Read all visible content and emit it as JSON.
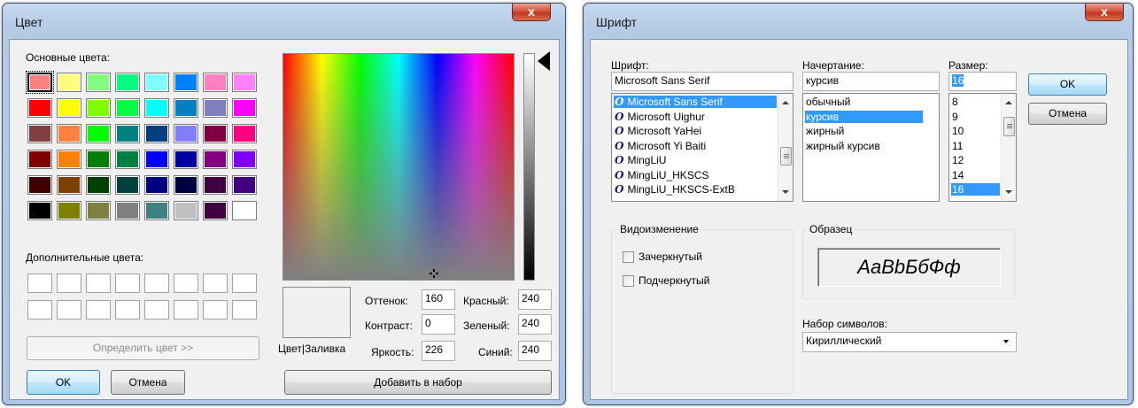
{
  "color_dialog": {
    "title": "Цвет",
    "close_label": "x",
    "basic_colors_label": "Основные цвета:",
    "basic_colors": [
      [
        "#ff8080",
        "#ffff80",
        "#80ff80",
        "#00ff80",
        "#80ffff",
        "#0080ff",
        "#ff80c0",
        "#ff80ff"
      ],
      [
        "#ff0000",
        "#ffff00",
        "#80ff00",
        "#00ff40",
        "#00ffff",
        "#0080c0",
        "#8080c0",
        "#ff00ff"
      ],
      [
        "#804040",
        "#ff8040",
        "#00ff00",
        "#008080",
        "#004080",
        "#8080ff",
        "#800040",
        "#ff0080"
      ],
      [
        "#800000",
        "#ff8000",
        "#008000",
        "#008040",
        "#0000ff",
        "#0000a0",
        "#800080",
        "#8000ff"
      ],
      [
        "#400000",
        "#804000",
        "#004000",
        "#004040",
        "#000080",
        "#000040",
        "#400040",
        "#400080"
      ],
      [
        "#000000",
        "#808000",
        "#808040",
        "#808080",
        "#408080",
        "#c0c0c0",
        "#400040",
        "#ffffff"
      ]
    ],
    "custom_colors_label": "Дополнительные цвета:",
    "define_button": "Определить цвет >>",
    "ok_button": "OK",
    "cancel_button": "Отмена",
    "preview_label": "Цвет|Заливка",
    "hue_label": "Оттенок:",
    "hue_value": "160",
    "sat_label": "Контраст:",
    "sat_value": "0",
    "lum_label": "Яркость:",
    "lum_value": "226",
    "red_label": "Красный:",
    "red_value": "240",
    "green_label": "Зеленый:",
    "green_value": "240",
    "blue_label": "Синий:",
    "blue_value": "240",
    "add_button": "Добавить в набор",
    "current_color": "#f0f0f0"
  },
  "font_dialog": {
    "title": "Шрифт",
    "close_label": "x",
    "font_label": "Шрифт:",
    "font_value": "Microsoft Sans Serif",
    "fonts": [
      "Microsoft Sans Serif",
      "Microsoft Uighur",
      "Microsoft YaHei",
      "Microsoft Yi Baiti",
      "MingLiU",
      "MingLiU_HKSCS",
      "MingLiU_HKSCS-ExtB"
    ],
    "style_label": "Начертание:",
    "style_value": "курсив",
    "styles": [
      "обычный",
      "курсив",
      "жирный",
      "жирный курсив"
    ],
    "size_label": "Размер:",
    "size_value": "16",
    "sizes": [
      "8",
      "9",
      "10",
      "11",
      "12",
      "14",
      "16"
    ],
    "ok_button": "OK",
    "cancel_button": "Отмена",
    "effects_label": "Видоизменение",
    "strikeout_label": "Зачеркнутый",
    "underline_label": "Подчеркнутый",
    "sample_group_label": "Образец",
    "sample_text": "AaBbБбФф",
    "charset_label": "Набор символов:",
    "charset_value": "Кириллический",
    "font_icon_glyph": "O"
  }
}
